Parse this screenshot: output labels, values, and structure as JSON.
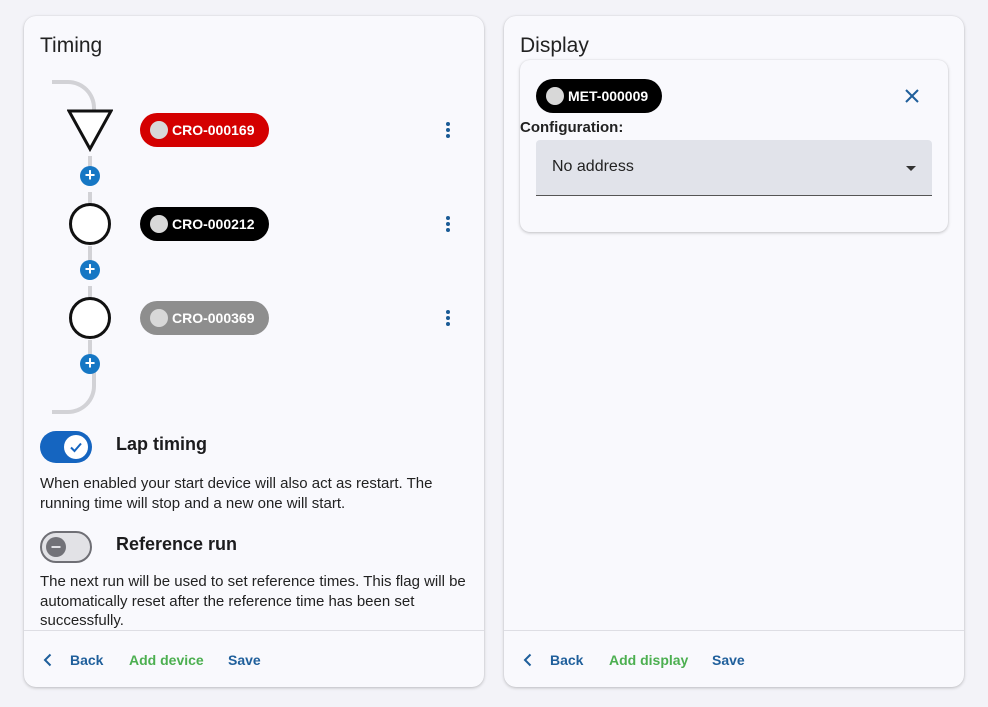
{
  "timing": {
    "title": "Timing",
    "devices": [
      {
        "id": "CRO-000169",
        "color": "#d40000",
        "icon": "triangle-down-icon"
      },
      {
        "id": "CRO-000212",
        "color": "#000000",
        "icon": "circle-icon"
      },
      {
        "id": "CRO-000369",
        "color": "#8e8e8e",
        "icon": "circle-icon"
      }
    ],
    "lap_timing": {
      "label": "Lap timing",
      "enabled": true,
      "description": "When enabled your start device will also act as restart. The running time will stop and a new one will start."
    },
    "reference_run": {
      "label": "Reference run",
      "enabled": false,
      "description": "The next run will be used to set reference times. This flag will be automatically reset after the reference time has been set successfully."
    },
    "footer": {
      "back": "Back",
      "add": "Add device",
      "save": "Save"
    }
  },
  "display": {
    "title": "Display",
    "device": {
      "id": "MET-000009",
      "color": "#000000"
    },
    "configuration_label": "Configuration:",
    "configuration_value": "No address",
    "footer": {
      "back": "Back",
      "add": "Add display",
      "save": "Save"
    }
  },
  "colors": {
    "accent": "#1565c0",
    "link": "#1f5f9b",
    "add": "#4caf50",
    "plus": "#1677c4"
  }
}
